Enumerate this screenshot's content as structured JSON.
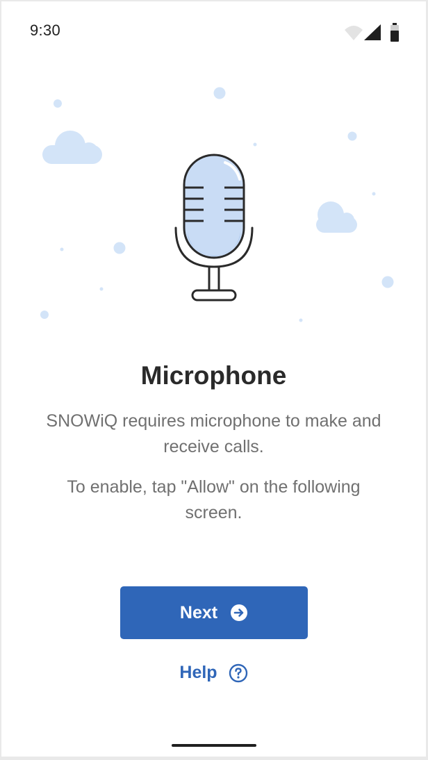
{
  "status_bar": {
    "time": "9:30",
    "icons": [
      "wifi-icon",
      "cellular-signal-icon",
      "battery-icon"
    ]
  },
  "illustration": {
    "icon": "microphone-icon",
    "decorations": [
      "cloud-icon",
      "cloud-icon",
      "dot-icon"
    ]
  },
  "content": {
    "title": "Microphone",
    "description": "SNOWiQ requires microphone to make and receive calls.",
    "instruction": "To enable, tap \"Allow\" on the following screen."
  },
  "actions": {
    "next_label": "Next",
    "next_icon": "arrow-right-circle-icon",
    "help_label": "Help",
    "help_icon": "question-circle-icon"
  },
  "colors": {
    "accent": "#2f66b8",
    "illustration_fill": "#d3e4f8",
    "title": "#2a2a2a",
    "body_text": "#707070"
  }
}
